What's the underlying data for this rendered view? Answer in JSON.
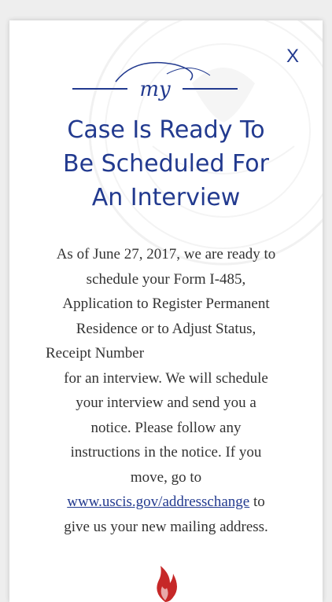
{
  "modal": {
    "close_label": "X",
    "logo_text": "my",
    "title_lines": [
      "Case Is Ready To",
      "Be Scheduled For",
      "An Interview"
    ],
    "body_lines": [
      "As of June 27, 2017, we are ready to",
      "schedule your Form I-485,",
      "Application to Register Permanent",
      "Residence or to Adjust Status,"
    ],
    "receipt_label": "Receipt Number",
    "body_lines_2": [
      "for an interview. We will schedule",
      "your interview and send you a",
      "notice. Please follow any",
      "instructions in the notice. If you",
      "move, go to"
    ],
    "link_text": "www.uscis.gov/addresschange",
    "link_suffix": " to",
    "last_line": "give us your new mailing address."
  },
  "colors": {
    "accent": "#223a8f",
    "text": "#333333",
    "flame": "#c62828"
  },
  "icons": {
    "close": "close-icon",
    "seal": "dhs-seal-watermark",
    "flame": "flame-icon"
  }
}
